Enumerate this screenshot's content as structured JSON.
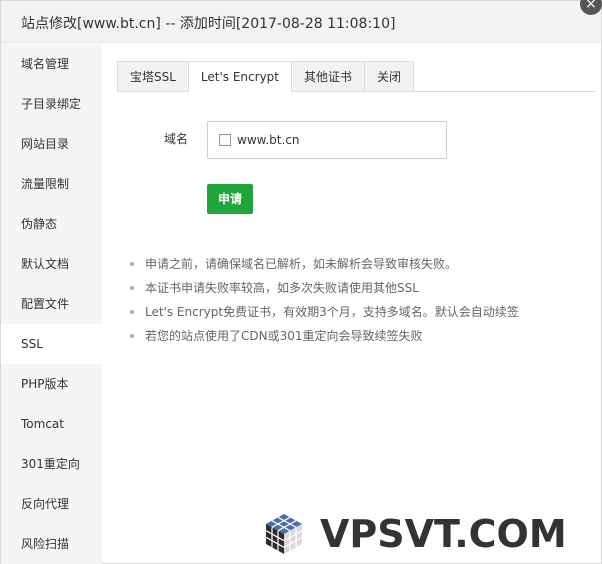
{
  "window": {
    "title": "站点修改[www.bt.cn] -- 添加时间[2017-08-28 11:08:10]",
    "close_glyph": "×"
  },
  "sidebar": {
    "items": [
      {
        "label": "域名管理"
      },
      {
        "label": "子目录绑定"
      },
      {
        "label": "网站目录"
      },
      {
        "label": "流量限制"
      },
      {
        "label": "伪静态"
      },
      {
        "label": "默认文档"
      },
      {
        "label": "配置文件"
      },
      {
        "label": "SSL",
        "active": true
      },
      {
        "label": "PHP版本"
      },
      {
        "label": "Tomcat"
      },
      {
        "label": "301重定向"
      },
      {
        "label": "反向代理"
      },
      {
        "label": "风险扫描"
      }
    ]
  },
  "tabs": [
    {
      "label": "宝塔SSL"
    },
    {
      "label": "Let's Encrypt",
      "active": true
    },
    {
      "label": "其他证书"
    },
    {
      "label": "关闭"
    }
  ],
  "form": {
    "domain_label": "域名",
    "domains": [
      {
        "name": "www.bt.cn",
        "checked": false
      }
    ],
    "apply_label": "申请"
  },
  "notes": [
    "申请之前，请确保域名已解析，如未解析会导致审核失败。",
    "本证书申请失败率较高，如多次失败请使用其他SSL",
    "Let's Encrypt免费证书，有效期3个月，支持多域名。默认会自动续签",
    "若您的站点使用了CDN或301重定向会导致续签失败"
  ],
  "watermark": {
    "text": "VPSVT.COM"
  },
  "colors": {
    "accent_green": "#20a53a",
    "sidebar_bg": "#f5f5f5",
    "titlebar_bg": "#f3f3f3"
  }
}
